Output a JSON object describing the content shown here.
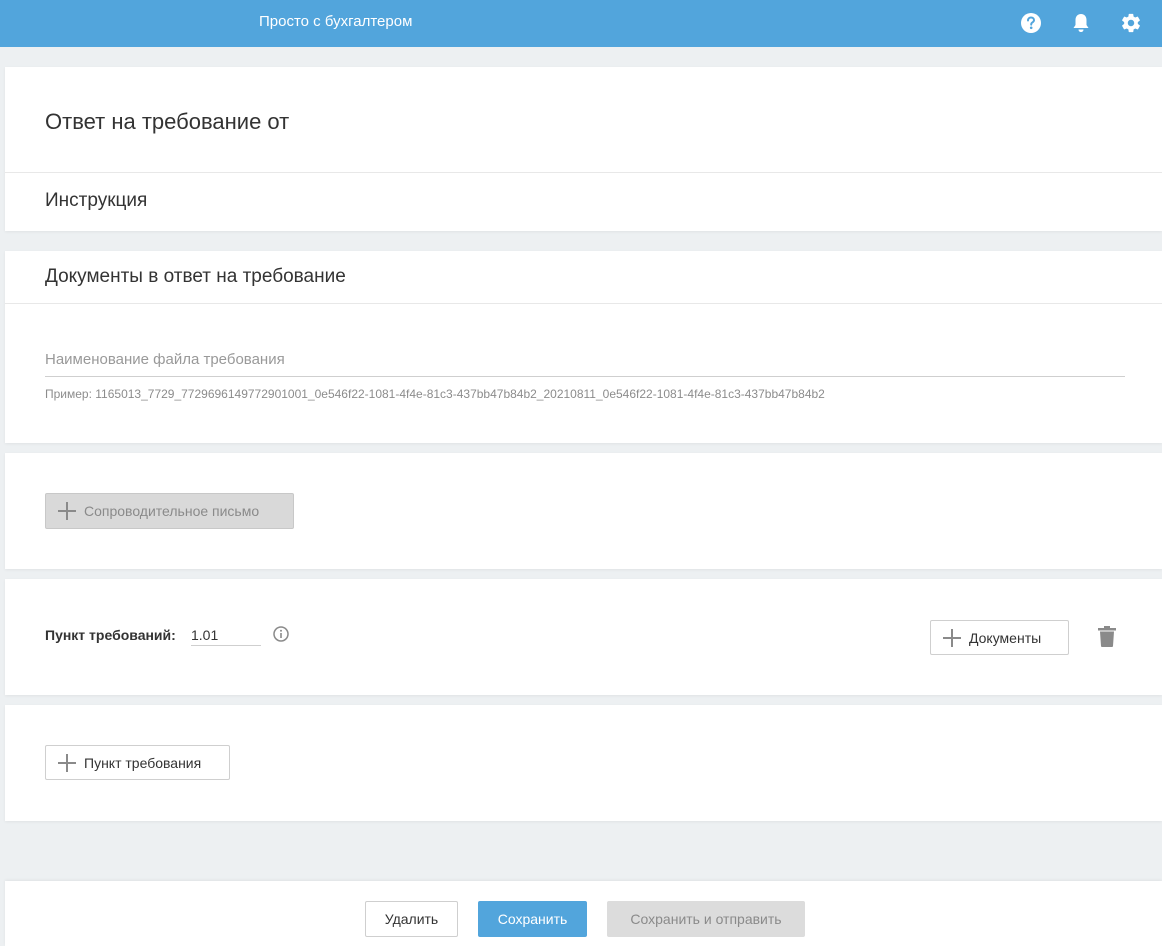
{
  "header": {
    "app_title": "Просто с бухгалтером",
    "icons": [
      "help-icon",
      "bell-icon",
      "gear-icon"
    ]
  },
  "page": {
    "title": "Ответ на требование от"
  },
  "instruction": {
    "title": "Инструкция"
  },
  "documents": {
    "title": "Документы в ответ на требование",
    "filename_label": "Наименование файла требования",
    "filename_value": "",
    "example": "Пример: 1165013_7729_7729696149772901001_0e546f22-1081-4f4e-81c3-437bb47b84b2_20210811_0e546f22-1081-4f4e-81c3-437bb47b84b2"
  },
  "cover_letter": {
    "button_label": "Сопроводительное письмо"
  },
  "requirement_item": {
    "label": "Пункт требований:",
    "value": "1.01",
    "documents_button": "Документы"
  },
  "add_item": {
    "button_label": "Пункт требования"
  },
  "footer": {
    "delete_label": "Удалить",
    "save_label": "Сохранить",
    "save_send_label": "Сохранить и отправить"
  },
  "colors": {
    "accent": "#52a5dc",
    "background": "#edf0f2"
  }
}
